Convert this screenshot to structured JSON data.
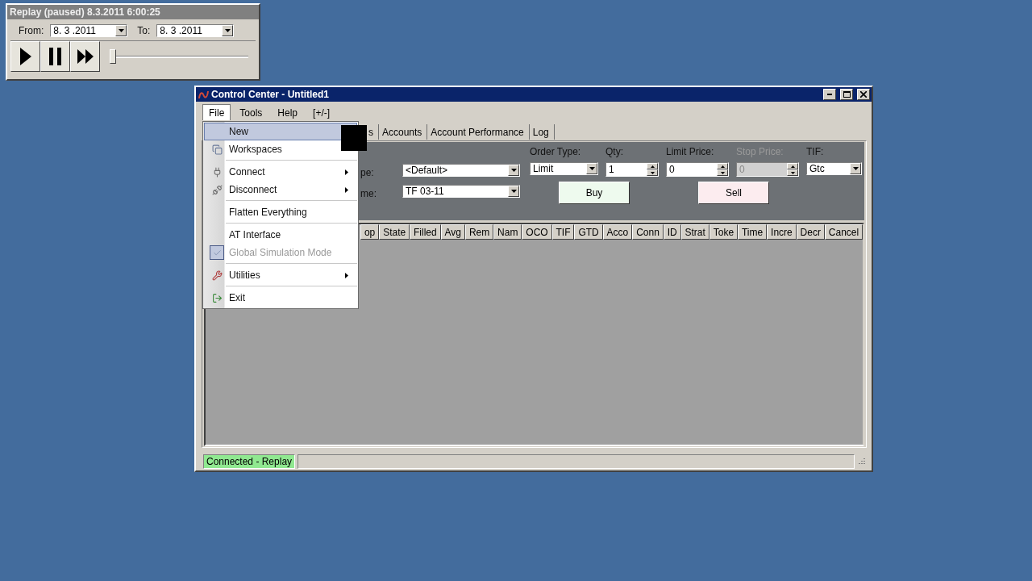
{
  "replay_window": {
    "title": "Replay (paused) 8.3.2011 6:00:25",
    "from_label": "From:",
    "from_value": "8. 3 .2011",
    "to_label": "To:",
    "to_value": "8. 3 .2011",
    "timeline": {
      "level": 0
    }
  },
  "window": {
    "title": "Control Center - Untitled1"
  },
  "menu_bar": [
    {
      "label": "File",
      "selected": true
    },
    {
      "label": "Tools",
      "selected": false
    },
    {
      "label": "Help",
      "selected": false
    },
    {
      "label": "[+/-]",
      "selected": false
    }
  ],
  "file_menu": [
    {
      "kind": "item",
      "label": "New",
      "selected": true,
      "submenu": false,
      "disabled": false,
      "checked": false
    },
    {
      "kind": "item",
      "label": "Workspaces",
      "selected": false,
      "submenu": false,
      "disabled": false,
      "checked": false
    },
    {
      "kind": "separator"
    },
    {
      "kind": "item",
      "label": "Connect",
      "selected": false,
      "submenu": true,
      "disabled": false,
      "checked": false
    },
    {
      "kind": "item",
      "label": "Disconnect",
      "selected": false,
      "submenu": true,
      "disabled": false,
      "checked": false
    },
    {
      "kind": "separator"
    },
    {
      "kind": "item",
      "label": "Flatten Everything",
      "selected": false,
      "submenu": false,
      "disabled": false,
      "checked": false
    },
    {
      "kind": "separator"
    },
    {
      "kind": "item",
      "label": "AT Interface",
      "selected": false,
      "submenu": false,
      "disabled": false,
      "checked": false
    },
    {
      "kind": "item",
      "label": "Global Simulation Mode",
      "selected": false,
      "submenu": false,
      "disabled": true,
      "checked": true
    },
    {
      "kind": "separator"
    },
    {
      "kind": "item",
      "label": "Utilities",
      "selected": false,
      "submenu": true,
      "disabled": false,
      "checked": false
    },
    {
      "kind": "separator"
    },
    {
      "kind": "item",
      "label": "Exit",
      "selected": false,
      "submenu": false,
      "disabled": false,
      "checked": false
    }
  ],
  "tabs": [
    {
      "label": "s",
      "selected": false
    },
    {
      "label": "Accounts",
      "selected": false
    },
    {
      "label": "Account Performance",
      "selected": false
    },
    {
      "label": "Log",
      "selected": false
    }
  ],
  "order_entry": {
    "left_fields": [
      {
        "label": "pe:",
        "value": "<Default>"
      },
      {
        "label": "me:",
        "value": "TF 03-11"
      }
    ],
    "fields": [
      {
        "kind": "combo",
        "label": "Order Type:",
        "value": "Limit",
        "disabled": false
      },
      {
        "kind": "spin",
        "label": "Qty:",
        "value": "1",
        "disabled": false
      },
      {
        "kind": "spin",
        "label": "Limit Price:",
        "value": "0",
        "disabled": false
      },
      {
        "kind": "spin",
        "label": "Stop Price:",
        "value": "0",
        "disabled": true
      },
      {
        "kind": "combo",
        "label": "TIF:",
        "value": "Gtc",
        "disabled": false
      }
    ],
    "buy": "Buy",
    "sell": "Sell"
  },
  "orders_table": {
    "columns": [
      "op",
      "State",
      "Filled",
      "Avg",
      "Rem",
      "Nam",
      "OCO",
      "TIF",
      "GTD",
      "Acco",
      "Conn",
      "ID",
      "Strat",
      "Toke",
      "Time",
      "Incre",
      "Decr",
      "Cancel"
    ]
  },
  "status_bar": {
    "connection": "Connected - Replay"
  }
}
